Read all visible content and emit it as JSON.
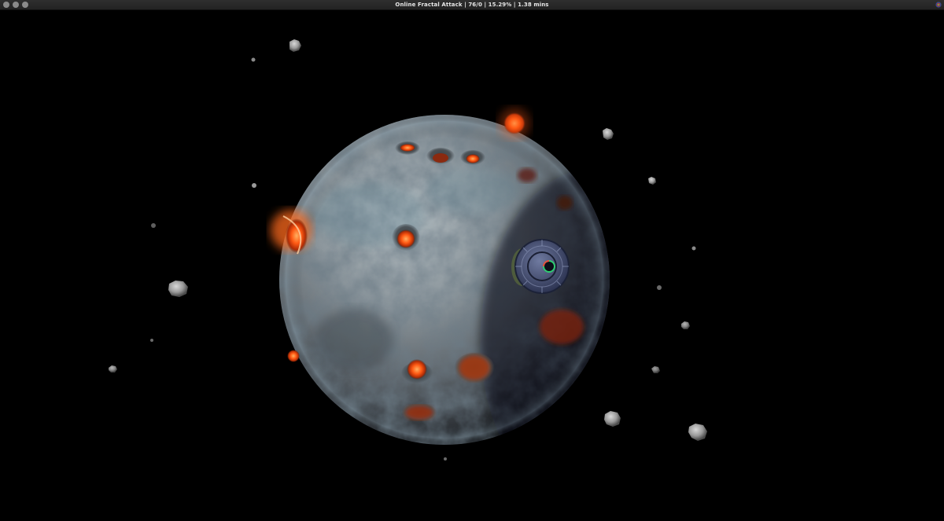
{
  "window": {
    "title": "Online Fractal Attack | 76/0 | 15.29% | 1.38 mins",
    "controls": [
      "close",
      "minimize",
      "maximize"
    ],
    "app_icon": "fractal-attack-app-icon"
  },
  "scene": {
    "planet": "planet",
    "hud_progress_percent": 15.29,
    "elapsed_minutes": 1.38,
    "asteroids_count_visible": 20,
    "colors": {
      "background": "#000000",
      "planet_surface": "#7d8890",
      "impact_glow": "#ff5a14",
      "spaceship_hull": "#4a5578"
    }
  }
}
